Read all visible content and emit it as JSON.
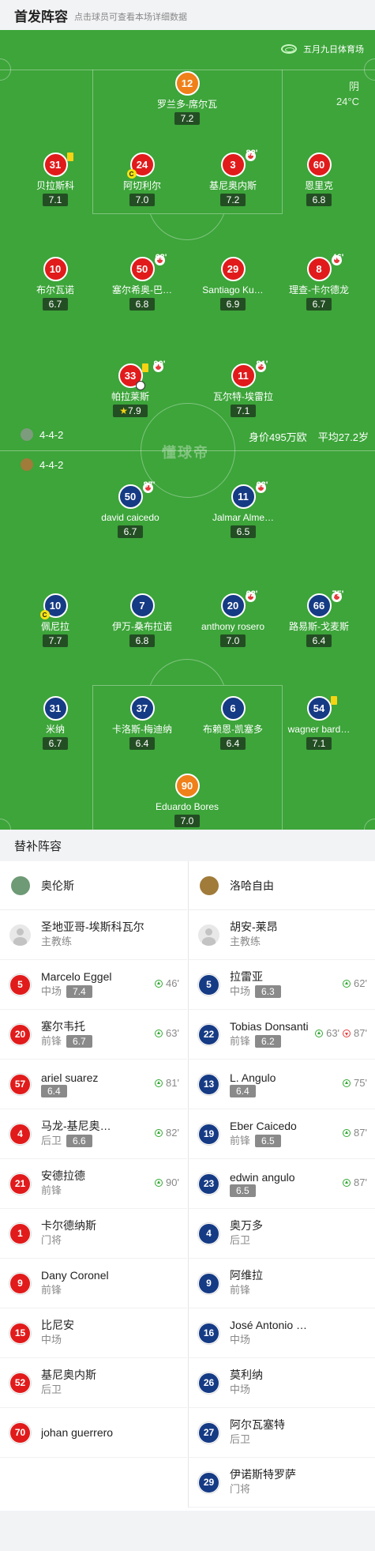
{
  "header": {
    "title": "首发阵容",
    "subtitle": "点击球员可查看本场详细数据"
  },
  "stadium": "五月九日体育场",
  "weather": {
    "condition": "阴",
    "temp": "24°C"
  },
  "home_formation": "4-4-2",
  "away_formation": "4-4-2",
  "market_value": "身价495万欧",
  "avg_age": "平均27.2岁",
  "watermark": "懂球帝",
  "home_players": [
    {
      "num": "12",
      "name": "罗兰多-席尔瓦",
      "rating": "7.2"
    },
    {
      "num": "31",
      "name": "贝拉斯科",
      "rating": "7.1"
    },
    {
      "num": "24",
      "name": "阿切利尔",
      "rating": "7.0"
    },
    {
      "num": "3",
      "name": "基尼奥内斯",
      "rating": "7.2",
      "sub": "82'"
    },
    {
      "num": "60",
      "name": "恩里克",
      "rating": "6.8"
    },
    {
      "num": "10",
      "name": "布尔瓦诺",
      "rating": "6.7"
    },
    {
      "num": "50",
      "name": "塞尔希奥-巴…",
      "rating": "6.8",
      "sub": "63'"
    },
    {
      "num": "29",
      "name": "Santiago Ku…",
      "rating": "6.9"
    },
    {
      "num": "8",
      "name": "理查-卡尔德龙",
      "rating": "6.7",
      "sub": "46'"
    },
    {
      "num": "33",
      "name": "帕拉莱斯",
      "rating": "7.9",
      "sub": "90'"
    },
    {
      "num": "11",
      "name": "瓦尔特-埃雷拉",
      "rating": "7.1",
      "sub": "81'"
    }
  ],
  "away_players": [
    {
      "num": "50",
      "name": "david caicedo",
      "rating": "6.7",
      "sub": "87'"
    },
    {
      "num": "11",
      "name": "Jalmar Alme…",
      "rating": "6.5",
      "sub": "63'"
    },
    {
      "num": "10",
      "name": "佩尼拉",
      "rating": "7.7"
    },
    {
      "num": "7",
      "name": "伊万-桑布拉诺",
      "rating": "6.8"
    },
    {
      "num": "20",
      "name": "anthony rosero",
      "rating": "7.0",
      "sub": "62'"
    },
    {
      "num": "66",
      "name": "路易斯-戈麦斯",
      "rating": "6.4",
      "sub": "75'"
    },
    {
      "num": "31",
      "name": "米纳",
      "rating": "6.7"
    },
    {
      "num": "37",
      "name": "卡洛斯-梅迪纳",
      "rating": "6.4"
    },
    {
      "num": "6",
      "name": "布赖恩-凯塞多",
      "rating": "6.4"
    },
    {
      "num": "54",
      "name": "wagner bard…",
      "rating": "7.1"
    },
    {
      "num": "90",
      "name": "Eduardo Bores",
      "rating": "7.0"
    }
  ],
  "subs_title": "替补阵容",
  "home_subs": {
    "team": "奥伦斯",
    "coach": {
      "name": "圣地亚哥-埃斯科瓦尔",
      "role": "主教练"
    },
    "players": [
      {
        "num": "5",
        "name": "Marcelo Eggel",
        "pos": "中场",
        "rating": "7.4",
        "ev": [
          "46'"
        ]
      },
      {
        "num": "20",
        "name": "塞尔韦托",
        "pos": "前锋",
        "rating": "6.7",
        "ev": [
          "63'"
        ]
      },
      {
        "num": "57",
        "name": "ariel suarez",
        "pos": "",
        "rating": "6.4",
        "ev": [
          "81'"
        ]
      },
      {
        "num": "4",
        "name": "马龙-基尼奥…",
        "pos": "后卫",
        "rating": "6.6",
        "ev": [
          "82'"
        ]
      },
      {
        "num": "21",
        "name": "安德拉德",
        "pos": "前锋",
        "rating": "",
        "ev": [
          "90'"
        ]
      },
      {
        "num": "1",
        "name": "卡尔德纳斯",
        "pos": "门将",
        "rating": "",
        "ev": []
      },
      {
        "num": "9",
        "name": "Dany Coronel",
        "pos": "前锋",
        "rating": "",
        "ev": []
      },
      {
        "num": "15",
        "name": "比尼安",
        "pos": "中场",
        "rating": "",
        "ev": []
      },
      {
        "num": "52",
        "name": "基尼奥内斯",
        "pos": "后卫",
        "rating": "",
        "ev": []
      },
      {
        "num": "70",
        "name": "johan guerrero",
        "pos": "",
        "rating": "",
        "ev": []
      }
    ]
  },
  "away_subs": {
    "team": "洛哈自由",
    "coach": {
      "name": "胡安-莱昂",
      "role": "主教练"
    },
    "players": [
      {
        "num": "5",
        "name": "拉雷亚",
        "pos": "中场",
        "rating": "6.3",
        "ev": [
          "62'"
        ]
      },
      {
        "num": "22",
        "name": "Tobias Donsanti",
        "pos": "前锋",
        "rating": "6.2",
        "ev": [
          "63'",
          "87'"
        ]
      },
      {
        "num": "13",
        "name": "L. Angulo",
        "pos": "",
        "rating": "6.4",
        "ev": [
          "75'"
        ]
      },
      {
        "num": "19",
        "name": "Eber Caicedo",
        "pos": "前锋",
        "rating": "6.5",
        "ev": [
          "87'"
        ]
      },
      {
        "num": "23",
        "name": "edwin angulo",
        "pos": "",
        "rating": "6.5",
        "ev": [
          "87'"
        ]
      },
      {
        "num": "4",
        "name": "奥万多",
        "pos": "后卫",
        "rating": "",
        "ev": []
      },
      {
        "num": "9",
        "name": "阿维拉",
        "pos": "前锋",
        "rating": "",
        "ev": []
      },
      {
        "num": "16",
        "name": "José Antonio …",
        "pos": "中场",
        "rating": "",
        "ev": []
      },
      {
        "num": "26",
        "name": "莫利纳",
        "pos": "中场",
        "rating": "",
        "ev": []
      },
      {
        "num": "27",
        "name": "阿尔瓦塞特",
        "pos": "后卫",
        "rating": "",
        "ev": []
      },
      {
        "num": "29",
        "name": "伊诺斯特罗萨",
        "pos": "门将",
        "rating": "",
        "ev": []
      }
    ]
  },
  "colors": {
    "pitch": "#3da53a",
    "home": "#e11b1b",
    "away": "#163b85",
    "gk": "#f08019"
  }
}
